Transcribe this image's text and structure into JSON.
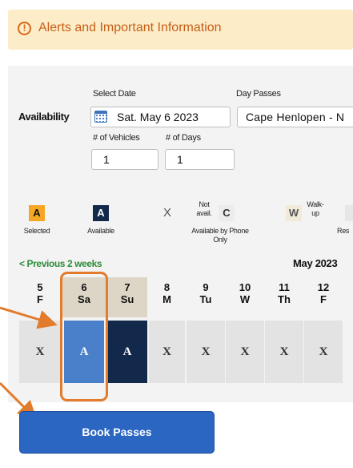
{
  "alert": {
    "icon": "exclamation-circle-icon",
    "text": "Alerts and Important Information"
  },
  "availability": {
    "label": "Availability",
    "select_date_label": "Select Date",
    "date_value": "Sat. May 6 2023",
    "day_passes_label": "Day Passes",
    "day_pass_value": "Cape Henlopen - N",
    "vehicles_label": "# of Vehicles",
    "vehicles_value": "1",
    "days_label": "# of Days",
    "days_value": "1"
  },
  "legend": [
    {
      "symbol": "A",
      "label": "Selected",
      "bg": "#f5a623",
      "fg": "#111111"
    },
    {
      "symbol": "A",
      "label": "Available",
      "bg": "#13294b",
      "fg": "#ffffff"
    },
    {
      "symbol": "X",
      "label": "",
      "bg": "transparent",
      "fg": "#555555"
    },
    {
      "symbol": "C",
      "label": "Available by Phone Only",
      "note": "Not avail.",
      "bg": "#ececec",
      "fg": "#333333"
    },
    {
      "symbol": "W",
      "label": "",
      "note": "Walk-up",
      "bg": "#f1ead8",
      "fg": "#555555"
    }
  ],
  "legend_extra": {
    "partial_label": "Res"
  },
  "calendar": {
    "prev_link": "< Previous 2 weeks",
    "month": "May 2023",
    "days": [
      {
        "num": "5",
        "dow": "F",
        "status": "X"
      },
      {
        "num": "6",
        "dow": "Sa",
        "status": "A",
        "state": "selected"
      },
      {
        "num": "7",
        "dow": "Su",
        "status": "A",
        "state": "available"
      },
      {
        "num": "8",
        "dow": "M",
        "status": "X"
      },
      {
        "num": "9",
        "dow": "Tu",
        "status": "X"
      },
      {
        "num": "10",
        "dow": "W",
        "status": "X"
      },
      {
        "num": "11",
        "dow": "Th",
        "status": "X"
      },
      {
        "num": "12",
        "dow": "F",
        "status": "X"
      }
    ]
  },
  "colors": {
    "accent": "#e27b2c",
    "selected_day": "#4a80c9",
    "available_day": "#13294b",
    "weekend_header": "#ddd6c7",
    "button": "#2b66c2"
  },
  "book_button": {
    "label": "Book Passes"
  }
}
